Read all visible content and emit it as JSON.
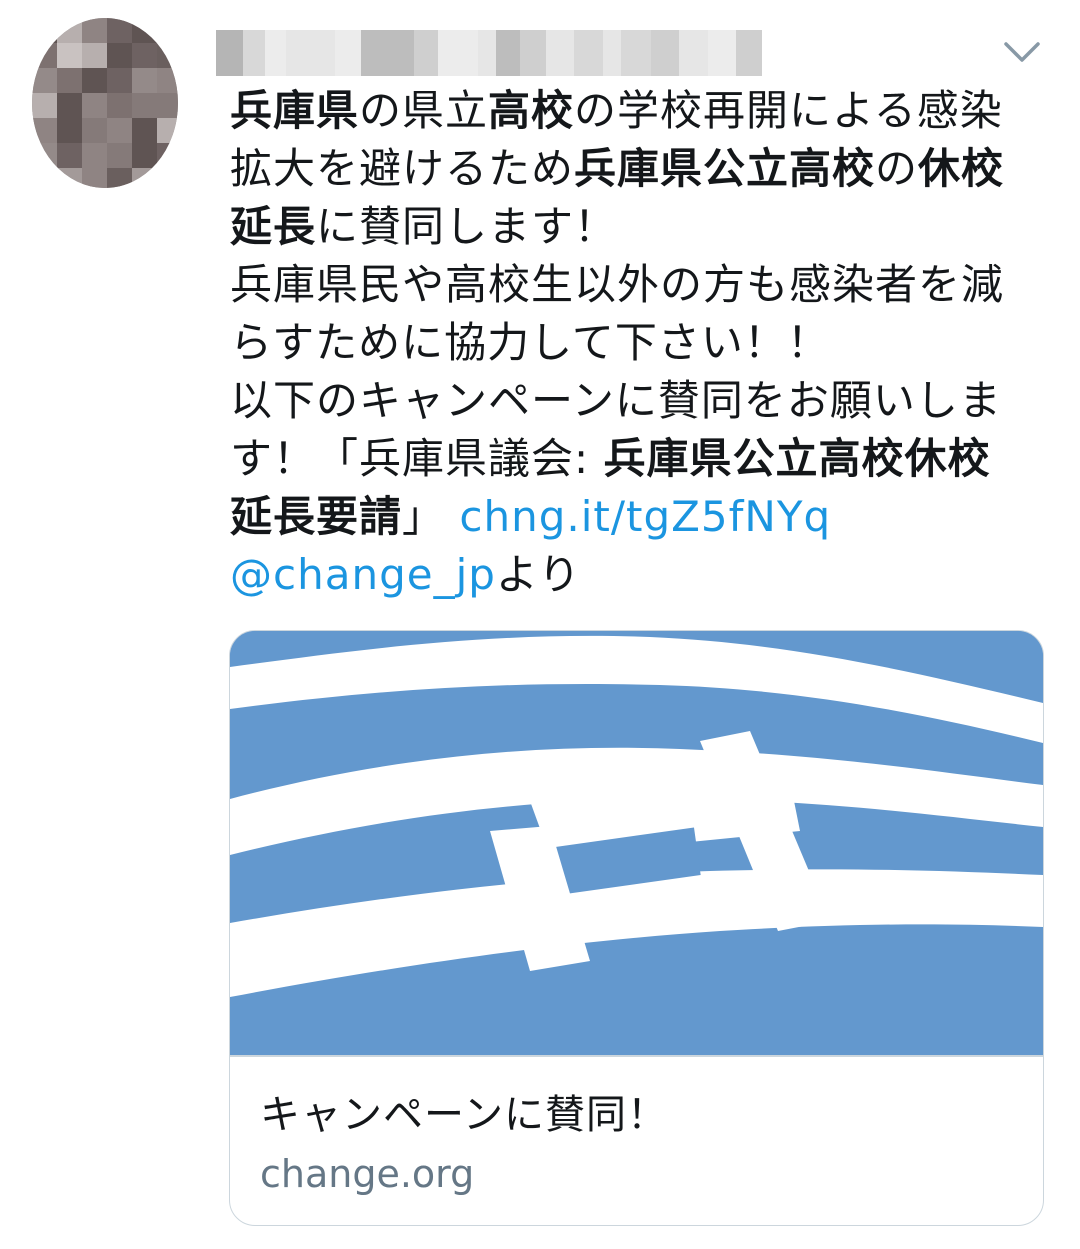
{
  "tweet": {
    "lines": [
      [
        {
          "t": "兵庫県",
          "b": true
        },
        {
          "t": "の県立"
        },
        {
          "t": "高校",
          "b": true
        },
        {
          "t": "の学校再開による感染"
        }
      ],
      [
        {
          "t": "拡大を避けるため"
        },
        {
          "t": "兵庫県公立高校",
          "b": true
        },
        {
          "t": "の"
        },
        {
          "t": "休校",
          "b": true
        }
      ],
      [
        {
          "t": "延長",
          "b": true
        },
        {
          "t": "に賛同します！"
        }
      ],
      [
        {
          "t": "兵庫県民や高校生以外の方も感染者を減"
        }
      ],
      [
        {
          "t": "らすために協力して下さい！！"
        }
      ],
      [
        {
          "t": "以下のキャンペーンに賛同をお願いしま"
        }
      ],
      [
        {
          "t": "す！「兵庫県議会: "
        },
        {
          "t": "兵庫県公立高校休校",
          "b": true
        }
      ],
      [
        {
          "t": "延長要請",
          "b": true
        },
        {
          "t": "」 "
        },
        {
          "t": "chng.it/tgZ5fNYq",
          "link": true
        }
      ],
      [
        {
          "t": "@change_jp",
          "link": true
        },
        {
          "t": "より"
        }
      ]
    ],
    "menu_icon": "chevron-down-icon"
  },
  "card": {
    "title": "キャンペーンに賛同！",
    "domain": "change.org",
    "image_icon": "hyogo-prefecture-emblem",
    "image_color": "#6398ce"
  },
  "colors": {
    "link": "#1b95e0",
    "text": "#14171a",
    "secondary": "#657786",
    "border": "#ccd6dd"
  }
}
